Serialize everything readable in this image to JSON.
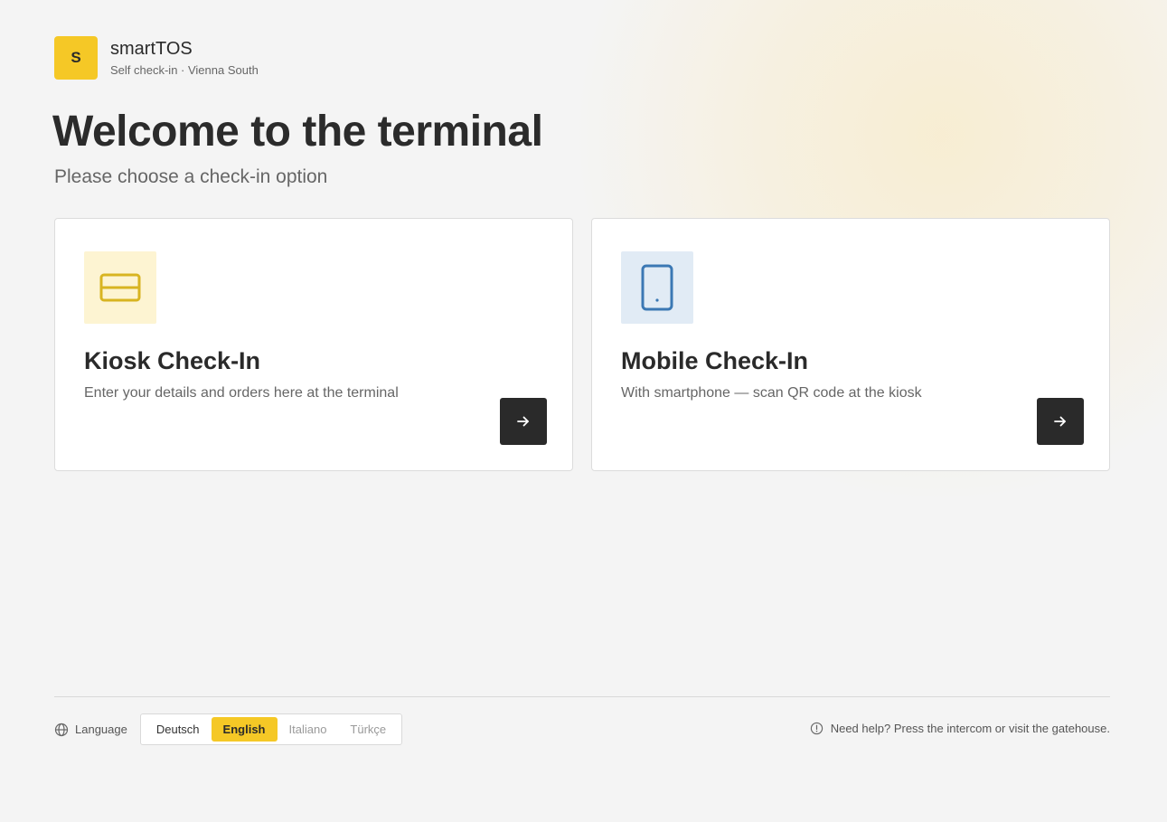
{
  "brand": {
    "logo_letter": "S",
    "name": "smartTOS",
    "subtitle": "Self check-in · Vienna South",
    "accent_color": "#f5c826"
  },
  "main": {
    "title": "Welcome to the terminal",
    "subtitle": "Please choose a check-in option"
  },
  "options": [
    {
      "title": "Kiosk Check-In",
      "description": "Enter your details and orders here at the terminal",
      "icon": "card-icon",
      "icon_color": "#d8b421",
      "icon_bg": "#fdf4d2",
      "action_icon": "arrow-right-icon"
    },
    {
      "title": "Mobile Check-In",
      "description": "With smartphone — scan QR code at the kiosk",
      "icon": "tablet-icon",
      "icon_color": "#3b78b4",
      "icon_bg": "#e1ebf5",
      "action_icon": "arrow-right-icon"
    }
  ],
  "footer": {
    "language_label": "Language",
    "languages": [
      "Deutsch",
      "English",
      "Italiano",
      "Türkçe"
    ],
    "selected_language": "English",
    "help_text": "Need help? Press the intercom or visit the gatehouse."
  }
}
